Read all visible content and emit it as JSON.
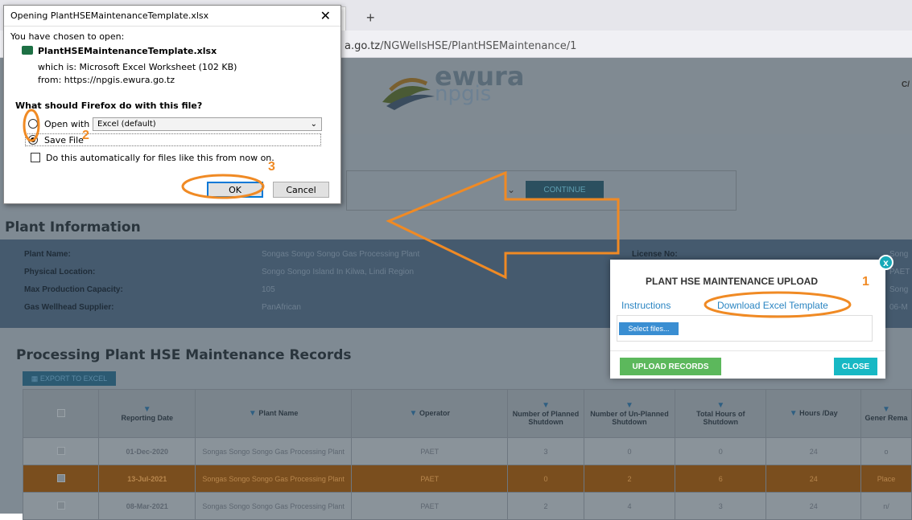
{
  "browser": {
    "url_host_suffix": "a.go.tz",
    "url_path": "/NGWellsHSE/PlantHSEMaintenance/1",
    "new_tab": "+"
  },
  "header": {
    "logo_word_1": "ewura",
    "logo_word_2": "npgis",
    "corner_text": "C/"
  },
  "filter": {
    "continue_label": "CONTINUE"
  },
  "plant_info": {
    "title": "Plant Information",
    "rows": [
      {
        "label": "Plant Name:",
        "value": "Songas Songo Songo Gas Processing Plant",
        "right_label": "License No:",
        "right_value": "Song"
      },
      {
        "label": "Physical Location:",
        "value": "Songo Songo Island In Kilwa, Lindi Region",
        "right_label": "",
        "right_value": "PAET"
      },
      {
        "label": "Max Production Capacity:",
        "value": "105",
        "right_label": "",
        "right_value": "Song"
      },
      {
        "label": "Gas Wellhead Supplier:",
        "value": "PanAfrican",
        "right_label": "",
        "right_value": "06-M"
      }
    ]
  },
  "records": {
    "title": "Processing Plant HSE Maintenance Records",
    "export_label": "EXPORT TO EXCEL",
    "columns": [
      "Reporting Date",
      "Plant Name",
      "Operator",
      "Number of Planned Shutdown",
      "Number of Un-Planned Shutdown",
      "Total Hours of Shutdown",
      "Hours /Day",
      "Gener Rema"
    ],
    "rows": [
      {
        "date": "01-Dec-2020",
        "plant": "Songas Songo Songo Gas Processing Plant",
        "operator": "PAET",
        "planned": "3",
        "unplanned": "0",
        "hours": "0",
        "per_day": "24",
        "remarks": "o"
      },
      {
        "date": "13-Jul-2021",
        "plant": "Songas Songo Songo Gas Processing Plant",
        "operator": "PAET",
        "planned": "0",
        "unplanned": "2",
        "hours": "6",
        "per_day": "24",
        "remarks": "Place"
      },
      {
        "date": "08-Mar-2021",
        "plant": "Songas Songo Songo Gas Processing Plant",
        "operator": "PAET",
        "planned": "2",
        "unplanned": "4",
        "hours": "3",
        "per_day": "24",
        "remarks": "n/"
      }
    ]
  },
  "ff_dialog": {
    "title": "Opening PlantHSEMaintenanceTemplate.xlsx",
    "chosen": "You have chosen to open:",
    "filename": "PlantHSEMaintenanceTemplate.xlsx",
    "which_is": "which is: Microsoft Excel Worksheet (102 KB)",
    "from": "from: https://npgis.ewura.go.tz",
    "question": "What should Firefox do with this file?",
    "open_with_label": "Open with",
    "open_with_value": "Excel (default)",
    "save_file_label": "Save File",
    "auto_label": "Do this automatically for files like this from now on.",
    "ok_label": "OK",
    "cancel_label": "Cancel"
  },
  "modal": {
    "title": "PLANT HSE MAINTENANCE UPLOAD",
    "instructions": "Instructions",
    "download": "Download Excel Template",
    "select_files": "Select files...",
    "upload_label": "UPLOAD RECORDS",
    "close_label": "CLOSE",
    "x_label": "x"
  },
  "annotations": {
    "step1": "1",
    "step2": "2",
    "step3": "3",
    "color": "#f08a24"
  }
}
